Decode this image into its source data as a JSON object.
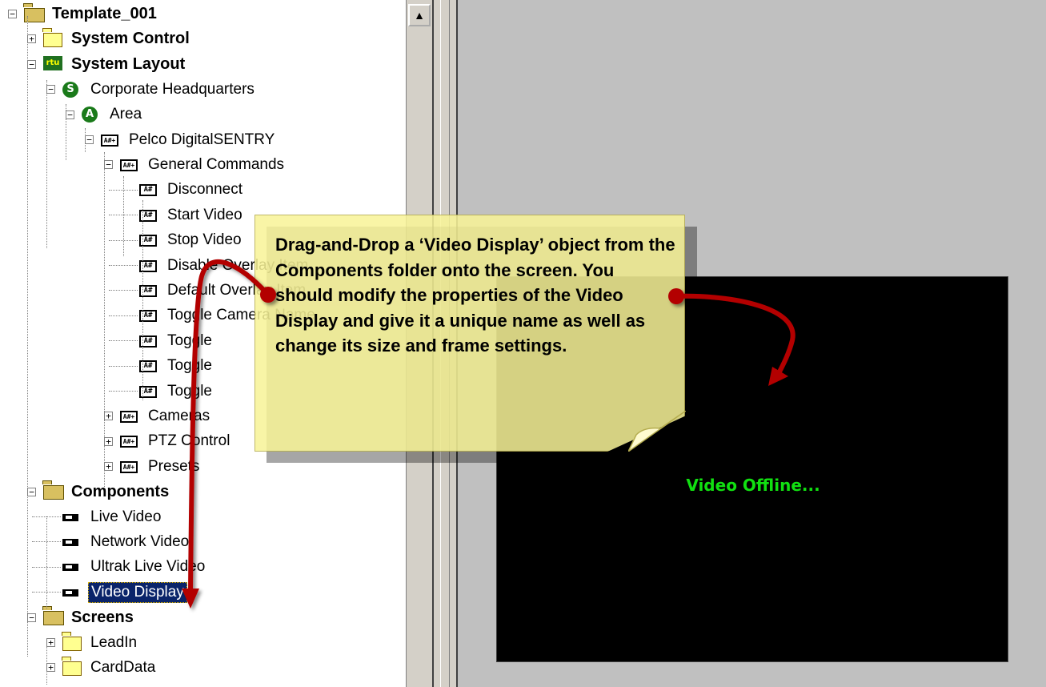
{
  "tree": {
    "items": [
      {
        "label": "Template_001",
        "bold": true,
        "icon": "folder-open-icon",
        "expander": "minus"
      },
      {
        "label": "System Control",
        "bold": true,
        "icon": "folder-closed-icon",
        "expander": "plus"
      },
      {
        "label": "System Layout",
        "bold": true,
        "icon": "rtu-icon",
        "expander": "minus"
      },
      {
        "label": "Corporate Headquarters",
        "bold": false,
        "icon": "site-icon",
        "expander": "minus"
      },
      {
        "label": "Area",
        "bold": false,
        "icon": "area-icon",
        "expander": "minus"
      },
      {
        "label": "Pelco DigitalSENTRY",
        "bold": false,
        "icon": "device-add-icon",
        "expander": "minus"
      },
      {
        "label": "General Commands",
        "bold": false,
        "icon": "device-add-icon",
        "expander": "minus"
      },
      {
        "label": "Disconnect",
        "bold": false,
        "icon": "command-icon",
        "expander": "none"
      },
      {
        "label": "Start Video",
        "bold": false,
        "icon": "command-icon",
        "expander": "none"
      },
      {
        "label": "Stop Video",
        "bold": false,
        "icon": "command-icon",
        "expander": "none"
      },
      {
        "label": "Disable Overlay Item",
        "bold": false,
        "icon": "command-icon",
        "expander": "none"
      },
      {
        "label": "Default Overlay Item",
        "bold": false,
        "icon": "command-icon",
        "expander": "none"
      },
      {
        "label": "Toggle Camera Name",
        "bold": false,
        "icon": "command-icon",
        "expander": "none"
      },
      {
        "label": "Toggle",
        "bold": false,
        "icon": "command-icon",
        "expander": "none"
      },
      {
        "label": "Toggle",
        "bold": false,
        "icon": "command-icon",
        "expander": "none"
      },
      {
        "label": "Toggle",
        "bold": false,
        "icon": "command-icon",
        "expander": "none"
      },
      {
        "label": "Cameras",
        "bold": false,
        "icon": "device-add-icon",
        "expander": "plus"
      },
      {
        "label": "PTZ Control",
        "bold": false,
        "icon": "device-add-icon",
        "expander": "plus"
      },
      {
        "label": "Presets",
        "bold": false,
        "icon": "device-add-icon",
        "expander": "plus"
      },
      {
        "label": "Components",
        "bold": true,
        "icon": "folder-open-icon",
        "expander": "minus"
      },
      {
        "label": "Live Video",
        "bold": false,
        "icon": "camera-icon",
        "expander": "none"
      },
      {
        "label": "Network Video",
        "bold": false,
        "icon": "camera-icon",
        "expander": "none"
      },
      {
        "label": "Ultrak Live Video",
        "bold": false,
        "icon": "camera-icon",
        "expander": "none"
      },
      {
        "label": "Video Display",
        "bold": false,
        "icon": "camera-icon",
        "expander": "none",
        "selected": true
      },
      {
        "label": "Screens",
        "bold": true,
        "icon": "folder-open-icon",
        "expander": "minus"
      },
      {
        "label": "LeadIn",
        "bold": false,
        "icon": "folder-closed-icon",
        "expander": "plus"
      },
      {
        "label": "CardData",
        "bold": false,
        "icon": "folder-closed-icon",
        "expander": "plus"
      }
    ]
  },
  "icon_glyphs": {
    "hash": "A#",
    "hash_plus": "A#+",
    "site": "S",
    "area": "A",
    "rtu": "rtu"
  },
  "scrollbar": {
    "up_arrow": "▲"
  },
  "video_display": {
    "status": "Video Offline..."
  },
  "callout": {
    "text": "Drag-and-Drop a ‘Video Display’ object from the Components folder onto the screen. You should modify the properties of the Video Display and give it a unique name as well as change its size and frame settings."
  },
  "colors": {
    "arrow": "#b30000",
    "callout_bg": "#f8f498",
    "video_text": "#11e011",
    "selection": "#0a246a"
  }
}
